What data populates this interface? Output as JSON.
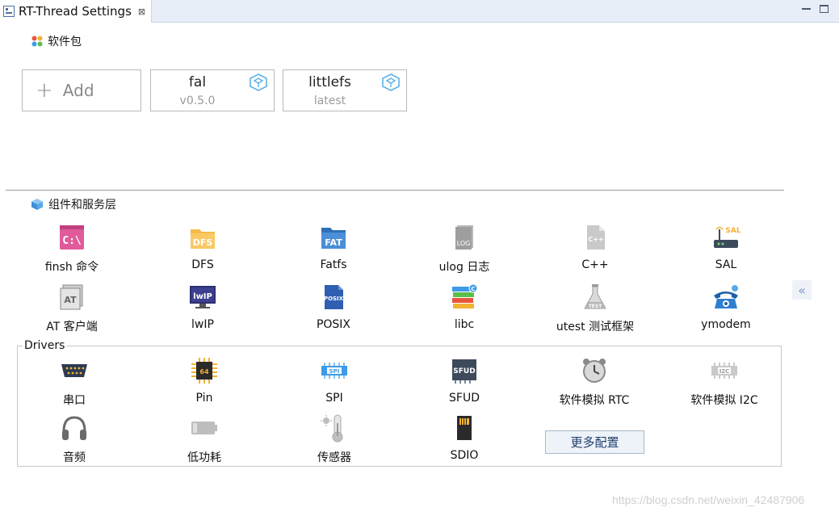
{
  "tab": {
    "title": "RT-Thread Settings",
    "close": "⊠"
  },
  "packages": {
    "heading": "软件包",
    "add_label": "Add",
    "items": [
      {
        "name": "fal",
        "version": "v0.5.0"
      },
      {
        "name": "littlefs",
        "version": "latest"
      }
    ]
  },
  "components": {
    "heading": "组件和服务层",
    "items": [
      {
        "label": "finsh 命令",
        "icon": "terminal-icon"
      },
      {
        "label": "DFS",
        "icon": "dfs-folder-icon"
      },
      {
        "label": "Fatfs",
        "icon": "fat-folder-icon"
      },
      {
        "label": "ulog 日志",
        "icon": "log-file-icon"
      },
      {
        "label": "C++",
        "icon": "cpp-file-icon"
      },
      {
        "label": "SAL",
        "icon": "router-icon"
      },
      {
        "label": "AT 客户端",
        "icon": "at-icon"
      },
      {
        "label": "lwIP",
        "icon": "lwip-monitor-icon"
      },
      {
        "label": "POSIX",
        "icon": "posix-file-icon"
      },
      {
        "label": "libc",
        "icon": "books-icon"
      },
      {
        "label": "utest 测试框架",
        "icon": "flask-icon"
      },
      {
        "label": "ymodem",
        "icon": "telephone-icon"
      }
    ]
  },
  "drivers": {
    "legend": "Drivers",
    "items": [
      {
        "label": "串口",
        "icon": "serial-port-icon"
      },
      {
        "label": "Pin",
        "icon": "chip-icon"
      },
      {
        "label": "SPI",
        "icon": "spi-icon"
      },
      {
        "label": "SFUD",
        "icon": "sfud-chip-icon"
      },
      {
        "label": "软件模拟 RTC",
        "icon": "alarm-clock-icon"
      },
      {
        "label": "软件模拟 I2C",
        "icon": "i2c-icon"
      },
      {
        "label": "音频",
        "icon": "headphones-icon"
      },
      {
        "label": "低功耗",
        "icon": "battery-icon"
      },
      {
        "label": "传感器",
        "icon": "thermometer-icon"
      },
      {
        "label": "SDIO",
        "icon": "sd-card-icon"
      }
    ],
    "more_button": "更多配置"
  },
  "collapse_glyph": "«",
  "watermark": "https://blog.csdn.net/weixin_42487906",
  "colors": {
    "tabbar_bg": "#e8eef7",
    "button_bg": "#eef3f9",
    "accent": "#4a90e2"
  }
}
